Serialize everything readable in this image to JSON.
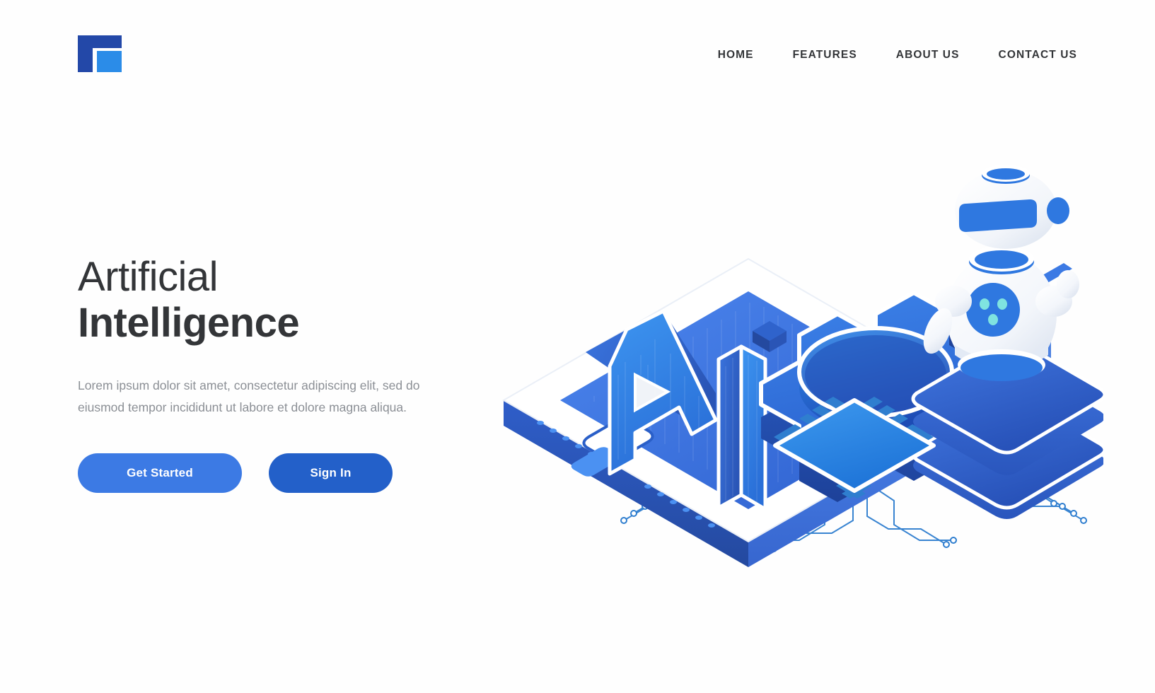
{
  "header": {
    "logo_name": "brand-logo",
    "nav": [
      {
        "label": "HOME"
      },
      {
        "label": "FEATURES"
      },
      {
        "label": "ABOUT US"
      },
      {
        "label": "CONTACT US"
      }
    ]
  },
  "hero": {
    "headline_line1": "Artificial",
    "headline_line2": "Intelligence",
    "paragraph": "Lorem ipsum dolor sit amet, consectetur adipiscing elit, sed do eiusmod tempor incididunt ut labore et dolore magna aliqua.",
    "primary_button": "Get Started",
    "secondary_button": "Sign In"
  },
  "illustration": {
    "ai_text": "AI",
    "elements": [
      "isometric-smartphone",
      "ai-3d-letters",
      "isometric-gear",
      "robot-character",
      "robot-pedestal",
      "cpu-chip",
      "circuit-traces"
    ]
  },
  "colors": {
    "brand_dark_blue": "#2348a8",
    "brand_light_blue": "#2b8ce8",
    "button_primary": "#3c7ae4",
    "button_secondary": "#2360c9",
    "heading_text": "#333538",
    "body_text": "#8b8f95",
    "background": "#ffffff"
  }
}
